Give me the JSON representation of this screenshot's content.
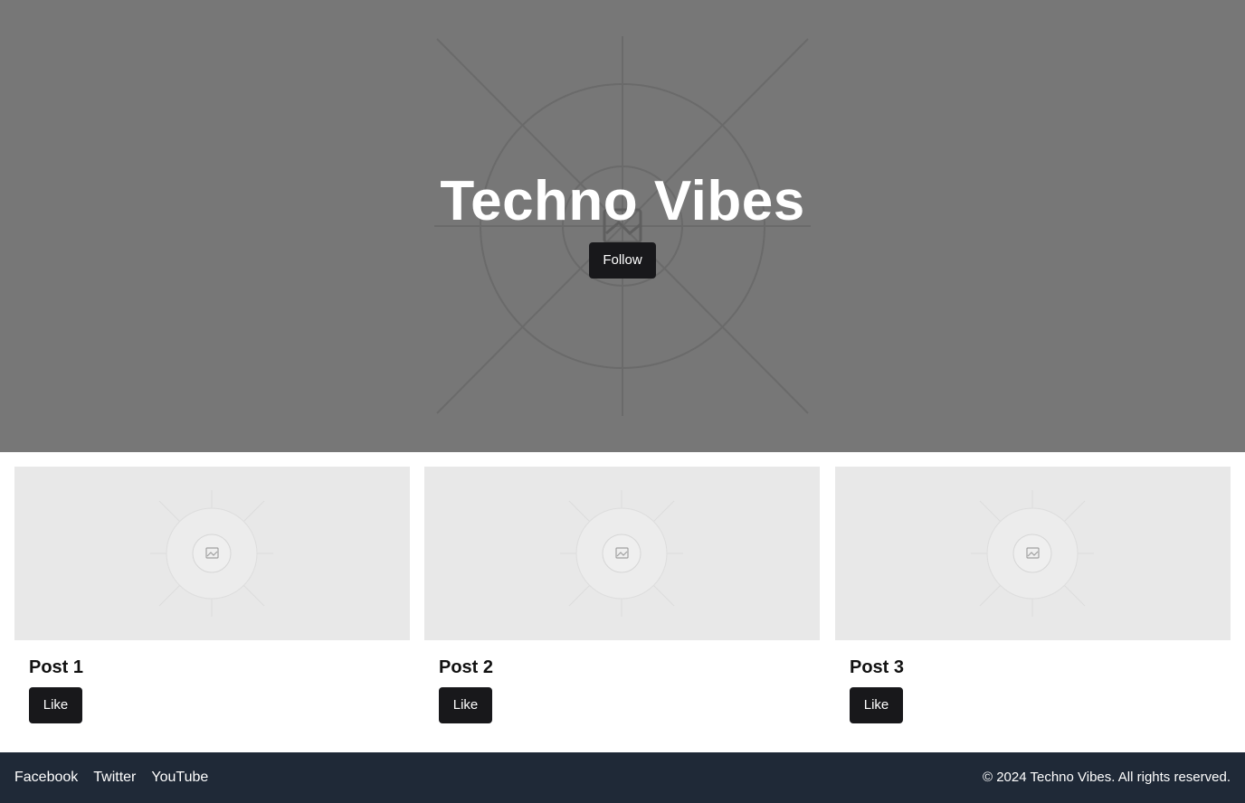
{
  "hero": {
    "title": "Techno Vibes",
    "follow_label": "Follow",
    "background_color": "#777777",
    "placeholder_icon": "image-placeholder-icon"
  },
  "posts": [
    {
      "title": "Post 1",
      "like_label": "Like",
      "image_icon": "image-placeholder-icon"
    },
    {
      "title": "Post 2",
      "like_label": "Like",
      "image_icon": "image-placeholder-icon"
    },
    {
      "title": "Post 3",
      "like_label": "Like",
      "image_icon": "image-placeholder-icon"
    }
  ],
  "footer": {
    "links": [
      "Facebook",
      "Twitter",
      "YouTube"
    ],
    "copyright": "© 2024 Techno Vibes. All rights reserved.",
    "background_color": "#1f2937"
  },
  "colors": {
    "button_bg": "#18181b",
    "button_text": "#ffffff",
    "card_image_bg": "#e8e8e8"
  }
}
